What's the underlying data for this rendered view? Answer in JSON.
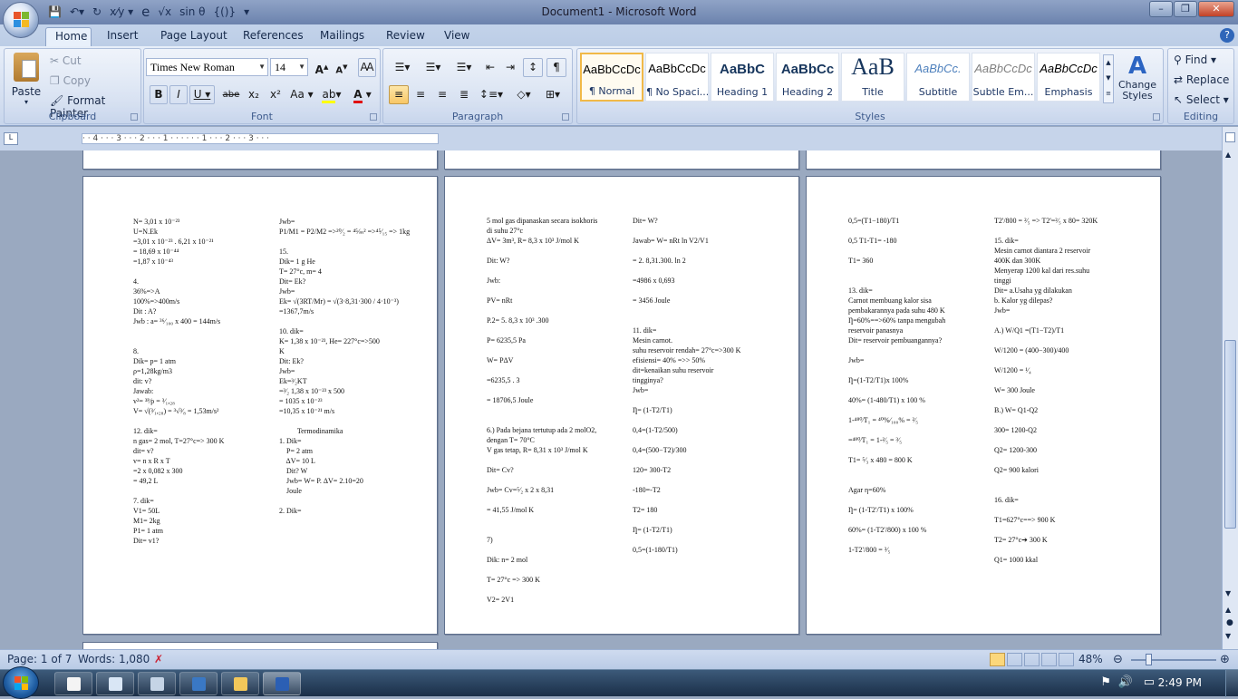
{
  "window": {
    "title": "Document1 - Microsoft Word"
  },
  "qat": {
    "equation_labels": [
      "e",
      "x",
      "√x",
      "sin θ",
      "{()}"
    ]
  },
  "tabs": [
    "Home",
    "Insert",
    "Page Layout",
    "References",
    "Mailings",
    "Review",
    "View"
  ],
  "clipboard": {
    "paste": "Paste",
    "cut": "Cut",
    "copy": "Copy",
    "format_painter": "Format Painter",
    "label": "Clipboard"
  },
  "font": {
    "name": "Times New Roman",
    "size": "14",
    "label": "Font"
  },
  "paragraph": {
    "label": "Paragraph"
  },
  "styles": {
    "label": "Styles",
    "preview": "AaBbCcDc",
    "items": [
      {
        "preview": "AaBbCcDc",
        "name": "¶ Normal"
      },
      {
        "preview": "AaBbCcDc",
        "name": "¶ No Spaci..."
      },
      {
        "preview": "AaBbC",
        "name": "Heading 1"
      },
      {
        "preview": "AaBbCc",
        "name": "Heading 2"
      },
      {
        "preview": "AaB",
        "name": "Title"
      },
      {
        "preview": "AaBbCc.",
        "name": "Subtitle"
      },
      {
        "preview": "AaBbCcDc",
        "name": "Subtle Em..."
      },
      {
        "preview": "AaBbCcDc",
        "name": "Emphasis"
      }
    ],
    "change_styles": "Change Styles"
  },
  "editing": {
    "find": "Find",
    "replace": "Replace",
    "select": "Select",
    "label": "Editing"
  },
  "ruler": {
    "text": "· · 4 · · · 3 · · · 2 · · · 1 · · ·   · · · 1 · · · 2 · · · 3 · · ·"
  },
  "pages": [
    {
      "col1": [
        "N= 3,01 x 10⁻²³",
        "U=N.Ek",
        "=3,01 x 10⁻²³ . 6,21 x 10⁻²¹",
        "= 18,69 x 10⁻⁴⁴",
        "=1,87 x 10⁻⁴³",
        "",
        "4.",
        "36%=>A",
        "100%=>400m/s",
        "Dit : A?",
        "Jwb : a= ³⁶⁄₁₀₀ x 400 = 144m/s",
        "",
        "",
        "8.",
        "Dik= p= 1 atm",
        "ρ=1,28kg/m3",
        "dit: v?",
        "Jawab:",
        "v²= ³ᴾ⁄ρ = ³⁄₁,₂₈",
        "V= √(³⁄₁,₂₈) = ³√³⁄₈ = 1,53m/s²",
        "",
        "12. dik=",
        "n gas= 2 mol, T=27°c=> 300 K",
        "dit= v?",
        "v= n x R x T",
        "=2 x 0,082 x 300",
        "= 49,2 L",
        "",
        "7. dik=",
        "V1= 50L",
        "M1= 2kg",
        "P1= 1 atm",
        "Dit= v1?"
      ],
      "col2": [
        "Jwb=",
        "P1/M1 = P2/M2 =>²⁰⁄₂ = ⁴⁵⁄ₘ² =>⁴⁵⁄₁₅ => 1kg",
        "",
        "15.",
        "Dik= 1 g He",
        "T= 27°c, m= 4",
        "Dit= Ek?",
        "Jwb=",
        "Ek= √(3RT/Mr) = √(3·8,31·300 / 4·10⁻³)",
        "=1367,7m/s",
        "",
        "10. dik=",
        "K= 1,38 x 10⁻²³, He= 227°c=>500",
        "K",
        "Dit: Ek?",
        "Jwb=",
        "Ek=³⁄₂KT",
        "=³⁄₂ 1,38 x 10⁻²³ x 500",
        "= 1035 x 10⁻²³",
        "=10,35 x 10⁻²¹ m/s",
        "",
        "          Termodinamika",
        "1. Dik=",
        "    P= 2 atm",
        "    ΔV= 10 L",
        "    Dit? W",
        "    Jwb= W= P. ΔV= 2.10=20",
        "    Joule",
        "",
        "2. Dik="
      ]
    },
    {
      "col1": [
        "5 mol gas dipanaskan secara isokhoris",
        "di suhu 27°c",
        "ΔV= 3m³, R= 8,3 x 10³ J/mol K",
        "",
        "Dit: W?",
        "",
        "Jwb:",
        "",
        "PV= nRt",
        "",
        "P.2= 5. 8,3 x 10³ .300",
        "",
        "P= 6235,5 Pa",
        "",
        "W= PΔV",
        "",
        "=6235,5 . 3",
        "",
        "= 18706,5 Joule",
        "",
        "",
        "6.) Pada bejana tertutup ada 2 molO2,",
        "dengan T= 70°C",
        "V gas tetap, R= 8,31 x 10³ J/mol K",
        "",
        "Dit= Cv?",
        "",
        "Jwb= Cv=⁵⁄₂ x 2 x 8,31",
        "",
        "= 41,55 J/mol K",
        "",
        "",
        "7)",
        "",
        "Dik: n= 2 mol",
        "",
        "T= 27°c => 300 K",
        "",
        "V2= 2V1"
      ],
      "col2": [
        "Dit= W?",
        "",
        "Jawab= W= nRt ln V2/V1",
        "",
        "= 2. 8,31.300. ln 2",
        "",
        "=4986 x 0,693",
        "",
        "= 3456 Joule",
        "",
        "",
        "11. dik=",
        "Mesin carnot.",
        "suhu reservoir rendah= 27°c=>300 K",
        "efisiensi= 40% =>> 50%",
        "dit=kenaikan suhu reservoir",
        "tingginya?",
        "Jwb=",
        "",
        "Ƞ= (1-T2/T1)",
        "",
        "0,4=(1-T2/500)",
        "",
        "0,4=(500−T2)/300",
        "",
        "120= 300-T2",
        "",
        "-180=-T2",
        "",
        "T2= 180",
        "",
        "Ƞ= (1-T2/T1)",
        "",
        "0,5=(1-180/T1)"
      ]
    },
    {
      "col1": [
        "0,5=(T1−180)/T1",
        "",
        "0,5 T1-T1= -180",
        "",
        "T1= 360",
        "",
        "",
        "13. dik=",
        "Carnot membuang kalor sisa",
        "pembakarannya pada suhu 480 K",
        "Ƞ=60%==>60% tanpa mengubah",
        "reservoir panasnya",
        "Dit= reservoir pembuangannya?",
        "",
        "Jwb=",
        "",
        "Ƞ=(1-T2/T1)x 100%",
        "",
        "40%= (1-480/T1) x 100 %",
        "",
        "1-⁴⁸⁰⁄T₁ = ⁴⁰%⁄₁₀₀% = ²⁄₅",
        "",
        "=⁴⁸⁰⁄T₁ = 1-²⁄₅ = ³⁄₅",
        "",
        "T1= ⁵⁄₃ x 480 = 800 K",
        "",
        "",
        "Agar η=60%",
        "",
        "Ƞ= (1-T2'/T1) x 100%",
        "",
        "60%= (1-T2'/800) x 100 %",
        "",
        "1-T2'/800 = ³⁄₅"
      ],
      "col2": [
        "T2'/800 = ²⁄₅ => T2'=²⁄₅ x 80= 320K",
        "",
        "15. dik=",
        "Mesin carnot diantara 2 reservoir",
        "400K dan 300K",
        "Menyerap 1200 kal dari res.suhu",
        "tinggi",
        "Dit= a.Usaha yg dilakukan",
        "b. Kalor yg dilepas?",
        "Jwb=",
        "",
        "A.) W/Q1 =(T1−T2)/T1",
        "",
        "W/1200 = (400−300)/400",
        "",
        "W/1200 = ¹⁄₄",
        "",
        "W= 300 Joule",
        "",
        "B.) W= Q1-Q2",
        "",
        "300= 1200-Q2",
        "",
        "Q2= 1200-300",
        "",
        "Q2= 900 kalori",
        "",
        "",
        "16. dik=",
        "",
        "T1=627°c==> 900 K",
        "",
        "T2= 27°c➔ 300 K",
        "",
        "Q1= 1000 kkal"
      ]
    }
  ],
  "status": {
    "page": "Page: 1 of 7",
    "words": "Words: 1,080",
    "zoom": "48%"
  },
  "taskbar": {
    "time": "2:49 PM"
  }
}
